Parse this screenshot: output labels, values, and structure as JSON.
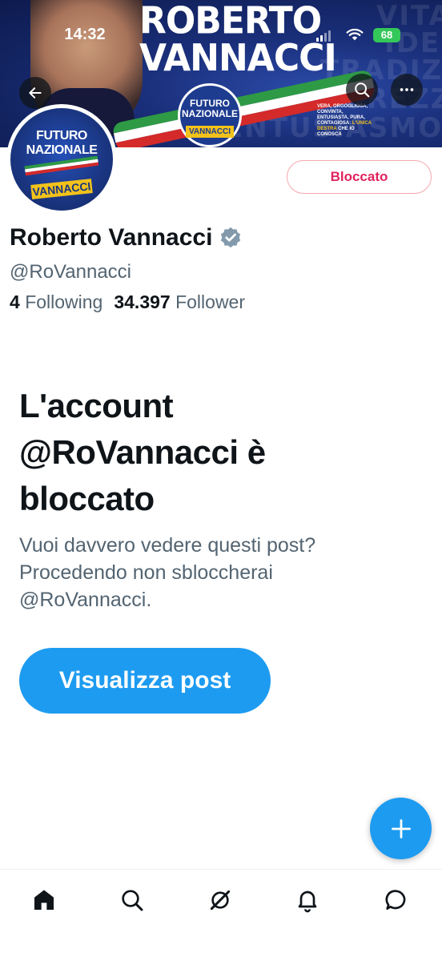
{
  "status_bar": {
    "time": "14:32",
    "battery": "68"
  },
  "banner": {
    "title_line1": "ROBERTO",
    "title_line2": "VANNACCI",
    "bg_words": [
      "VITALE",
      "IDENTITÀ",
      "TRADIZIONI",
      "SICUREZZA",
      "ENTUSIASMO"
    ],
    "logo_line1": "FUTURO",
    "logo_line2": "NAZIONALE",
    "logo_tag": "VANNACCI",
    "slogan_text": "VERA, ORGOGLIOSA, CONVINTA, ENTUSIASTA, PURA, CONTAGIOSA:",
    "slogan_highlight": "L'UNICA DESTRA",
    "slogan_end": "CHE IO CONOSCA"
  },
  "avatar": {
    "line1": "FUTURO",
    "line2": "NAZIONALE",
    "tag": "VANNACCI"
  },
  "profile": {
    "display_name": "Roberto Vannacci",
    "handle": "@RoVannacci",
    "following_count": "4",
    "following_label": "Following",
    "follower_count": "34.397",
    "follower_label": "Follower",
    "blocked_button": "Bloccato"
  },
  "blocked_notice": {
    "title": "L'account @RoVannacci è bloccato",
    "description": "Vuoi davvero vedere questi post? Procedendo non sbloccherai @RoVannacci.",
    "view_button": "Visualizza post"
  },
  "icons": {
    "back": "arrow-left-icon",
    "search": "search-icon",
    "more": "more-icon",
    "compose": "plus-icon",
    "nav": [
      "home-icon",
      "search-icon",
      "grok-icon",
      "bell-icon",
      "message-icon"
    ]
  },
  "colors": {
    "accent": "#1d9bf0",
    "blocked_red": "#e0245e",
    "verified_gray": "#829aab",
    "text_secondary": "#536471"
  }
}
